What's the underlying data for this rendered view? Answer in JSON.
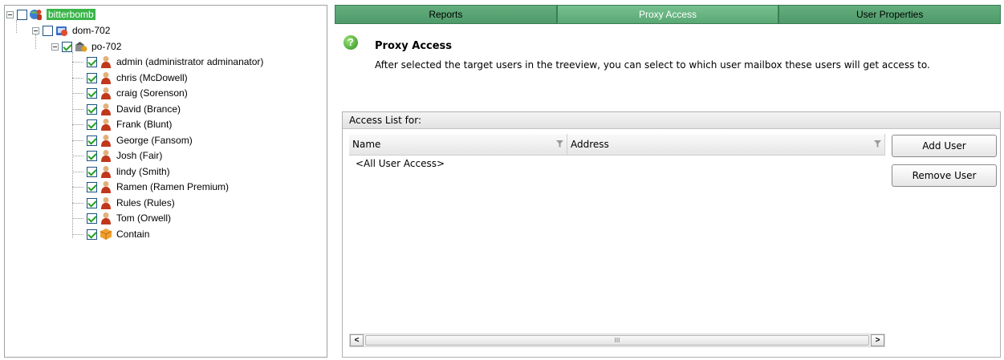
{
  "tree": {
    "root": {
      "label": "bitterbomb"
    },
    "domain": {
      "label": "dom-702"
    },
    "post_office": {
      "label": "po-702"
    },
    "users": [
      "admin (administrator  adminanator)",
      "chris (McDowell)",
      "craig (Sorenson)",
      "David (Brance)",
      "Frank (Blunt)",
      "George (Fansom)",
      "Josh (Fair)",
      "lindy (Smith)",
      "Ramen (Ramen Premium)",
      "Rules (Rules)",
      "Tom (Orwell)"
    ],
    "resource": {
      "label": "Contain"
    }
  },
  "tabs": [
    "Reports",
    "Proxy Access",
    "User Properties"
  ],
  "active_tab": "Proxy Access",
  "header": {
    "title": "Proxy Access",
    "description": "After selected the target users in the treeview, you can select to which user mailbox these users will get access to."
  },
  "access_list": {
    "heading": "Access List for:",
    "columns": [
      "Name",
      "Address"
    ],
    "rows": [
      {
        "name": "<All User Access>",
        "address": ""
      }
    ],
    "scroll_thumb": "III"
  },
  "buttons": {
    "add_user": "Add User",
    "remove_user": "Remove User"
  },
  "scroll": {
    "left": "<",
    "right": ">"
  },
  "colors": {
    "tab_green": "#5aa875",
    "selection_green": "#3bb54a",
    "check_green": "#21a121"
  }
}
